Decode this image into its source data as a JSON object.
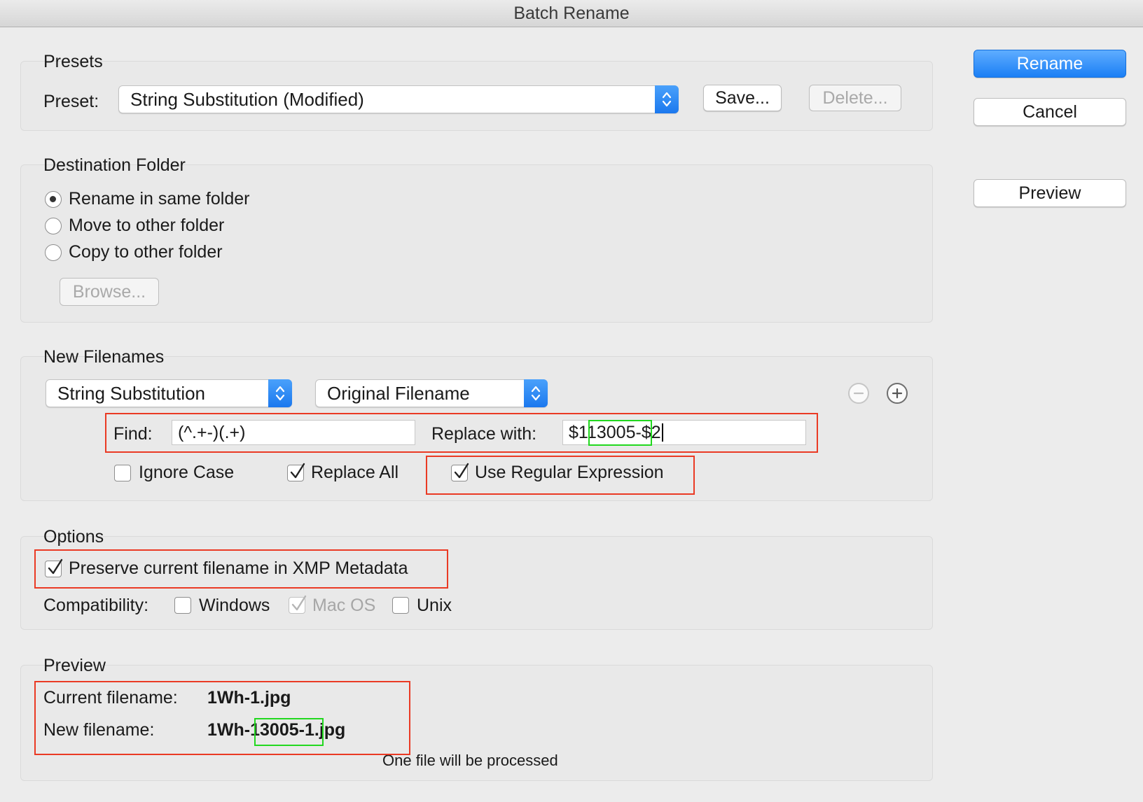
{
  "window": {
    "title": "Batch Rename"
  },
  "presets": {
    "section_label": "Presets",
    "preset_label": "Preset:",
    "preset_value": "String Substitution (Modified)",
    "save_label": "Save...",
    "delete_label": "Delete..."
  },
  "actions": {
    "rename": "Rename",
    "cancel": "Cancel",
    "preview": "Preview"
  },
  "destination": {
    "section_label": "Destination Folder",
    "options": [
      {
        "label": "Rename in same folder",
        "selected": true
      },
      {
        "label": "Move to other folder",
        "selected": false
      },
      {
        "label": "Copy to other folder",
        "selected": false
      }
    ],
    "browse_label": "Browse..."
  },
  "new_filenames": {
    "section_label": "New Filenames",
    "method": "String Substitution",
    "source": "Original Filename",
    "find_label": "Find:",
    "find_value": "(^.+-)(.+)",
    "replace_label": "Replace with:",
    "replace_prefix": "$1",
    "replace_highlight": "13005-",
    "replace_suffix": "$2",
    "ignore_case": {
      "label": "Ignore Case",
      "checked": false
    },
    "replace_all": {
      "label": "Replace All",
      "checked": true
    },
    "use_regex": {
      "label": "Use Regular Expression",
      "checked": true
    }
  },
  "options": {
    "section_label": "Options",
    "preserve": {
      "label": "Preserve current filename in XMP Metadata",
      "checked": true
    },
    "compat_label": "Compatibility:",
    "windows": {
      "label": "Windows",
      "checked": false
    },
    "macos": {
      "label": "Mac OS",
      "checked": true,
      "disabled": true
    },
    "unix": {
      "label": "Unix",
      "checked": false
    }
  },
  "preview": {
    "section_label": "Preview",
    "current_label": "Current filename:",
    "current_value": "1Wh-1.jpg",
    "new_label": "New filename:",
    "new_prefix": "1Wh-",
    "new_highlight": "13005-",
    "new_suffix": "1.jpg",
    "status": "One file will be processed"
  },
  "colors": {
    "accent_blue": "#1b7ff5",
    "annotation_red": "#ea3a24",
    "annotation_green": "#22d81f"
  }
}
